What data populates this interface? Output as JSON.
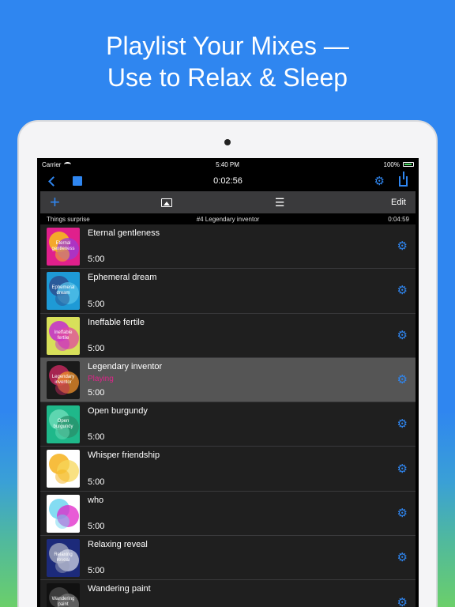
{
  "headline": {
    "line1": "Playlist Your Mixes —",
    "line2": "Use to Relax & Sleep"
  },
  "status_bar": {
    "carrier": "Carrier",
    "time": "5:40 PM",
    "battery": "100%"
  },
  "nav": {
    "timer": "0:02:56"
  },
  "toolbar": {
    "edit_label": "Edit"
  },
  "info_bar": {
    "left": "Things surprise",
    "center": "#4 Legendary inventor",
    "right": "0:04:59"
  },
  "playlist": [
    {
      "title": "Eternal gentleness",
      "thumb_label": "Eternal gentleness",
      "duration": "5:00",
      "status": "",
      "bg": "#e0208c",
      "c1": "#f7c21a",
      "c2": "#9b3ad6"
    },
    {
      "title": "Ephemeral dream",
      "thumb_label": "Ephemeral dream",
      "duration": "5:00",
      "status": "",
      "bg": "#1e9ad6",
      "c1": "#2b4f8f",
      "c2": "#55c2e8"
    },
    {
      "title": "Ineffable fertile",
      "thumb_label": "Ineffable fertile",
      "duration": "5:00",
      "status": "",
      "bg": "#d8e05a",
      "c1": "#c42bd0",
      "c2": "#e04aa0"
    },
    {
      "title": "Legendary inventor",
      "thumb_label": "Legendary inventor",
      "duration": "5:00",
      "status": "Playing",
      "bg": "#1a1a1a",
      "c1": "#c0285c",
      "c2": "#f0902a"
    },
    {
      "title": "Open burgundy",
      "thumb_label": "Open burgundy",
      "duration": "5:00",
      "status": "",
      "bg": "#1fb88a",
      "c1": "#6adbb6",
      "c2": "#2a8f6a"
    },
    {
      "title": "Whisper friendship",
      "thumb_label": "",
      "duration": "5:00",
      "status": "",
      "bg": "#ffffff",
      "c1": "#f6b21c",
      "c2": "#f7d75a"
    },
    {
      "title": "who",
      "thumb_label": "",
      "duration": "5:00",
      "status": "",
      "bg": "#ffffff",
      "c1": "#6fd6f0",
      "c2": "#e024c8"
    },
    {
      "title": "Relaxing reveal",
      "thumb_label": "Relaxing reveal",
      "duration": "5:00",
      "status": "",
      "bg": "#1c2a7a",
      "c1": "#9aa0b8",
      "c2": "#d0d4e6"
    },
    {
      "title": "Wandering paint",
      "thumb_label": "Wandering paint",
      "duration": "",
      "status": "",
      "bg": "#111111",
      "c1": "#444444",
      "c2": "#777777"
    }
  ],
  "colors": {
    "accent": "#2f86f0",
    "playing": "#e0248a",
    "background": "#2f86f0"
  }
}
